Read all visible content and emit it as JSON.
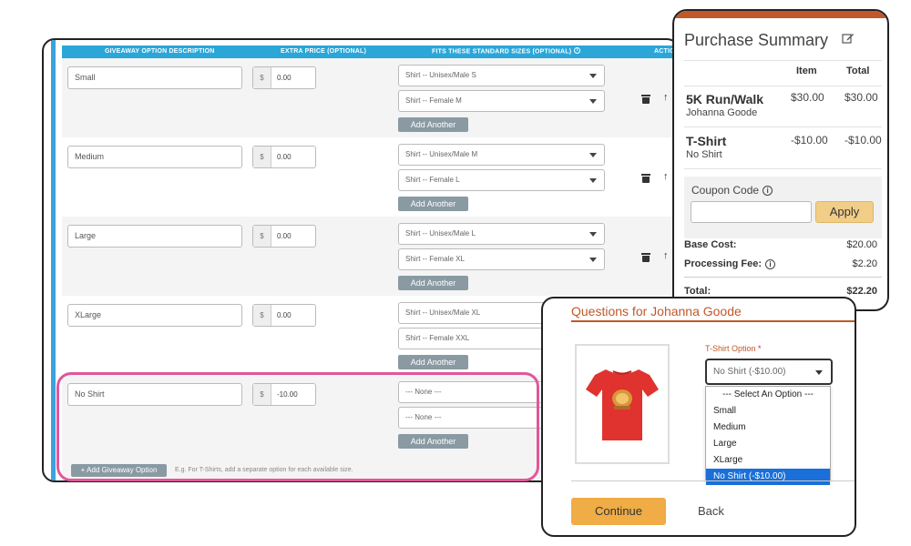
{
  "editor": {
    "columns": [
      "GIVEAWAY OPTION DESCRIPTION",
      "EXTRA PRICE (OPTIONAL)",
      "FITS THESE STANDARD SIZES (OPTIONAL)",
      "ACTIO"
    ],
    "currency": "$",
    "add_another_label": "Add Another",
    "rows": [
      {
        "description": "Small",
        "price": "0.00",
        "sizes": [
          "Shirt -- Unisex/Male S",
          "Shirt -- Female M"
        ]
      },
      {
        "description": "Medium",
        "price": "0.00",
        "sizes": [
          "Shirt -- Unisex/Male M",
          "Shirt -- Female L"
        ]
      },
      {
        "description": "Large",
        "price": "0.00",
        "sizes": [
          "Shirt -- Unisex/Male L",
          "Shirt -- Female XL"
        ]
      },
      {
        "description": "XLarge",
        "price": "0.00",
        "sizes": [
          "Shirt -- Unisex/Male XL",
          "Shirt -- Female XXL"
        ]
      },
      {
        "description": "No Shirt",
        "price": "-10.00",
        "sizes": [
          "--- None ---",
          "--- None ---"
        ]
      }
    ],
    "add_option_label": "+ Add Giveaway Option",
    "footer_hint": "E.g. For T-Shirts, add a separate option for each available size."
  },
  "summary": {
    "title": "Purchase Summary",
    "col_item": "Item",
    "col_total": "Total",
    "items": [
      {
        "name": "5K Run/Walk",
        "sub": "Johanna Goode",
        "item": "$30.00",
        "total": "$30.00"
      },
      {
        "name": "T-Shirt",
        "sub": "No Shirt",
        "item": "-$10.00",
        "total": "-$10.00"
      }
    ],
    "coupon_label": "Coupon Code",
    "coupon_value": "",
    "apply_label": "Apply",
    "base_cost_label": "Base Cost:",
    "base_cost": "$20.00",
    "processing_fee_label": "Processing Fee:",
    "processing_fee": "$2.20",
    "total_label": "Total:",
    "total": "$22.20"
  },
  "questions": {
    "title": "Questions for Johanna Goode",
    "field_label": "T-Shirt Option",
    "required_mark": "*",
    "selected_value": "No Shirt (-$10.00)",
    "options": [
      "--- Select An Option ---",
      "Small",
      "Medium",
      "Large",
      "XLarge",
      "No Shirt (-$10.00)"
    ],
    "continue_label": "Continue",
    "back_label": "Back"
  },
  "colors": {
    "accent_blue": "#2aa6d9",
    "highlight_pink": "#e0579b",
    "brand_orange": "#c0582a",
    "selected_option": "#1a6fd8",
    "continue_orange": "#f0ac45",
    "apply_yellow": "#f2cd87"
  },
  "icons": {
    "delete": "trash-icon",
    "move": "arrow-up-icon",
    "edit": "edit-icon",
    "info": "info-icon",
    "dropdown": "chevron-down-icon",
    "product": "t-shirt-image"
  }
}
